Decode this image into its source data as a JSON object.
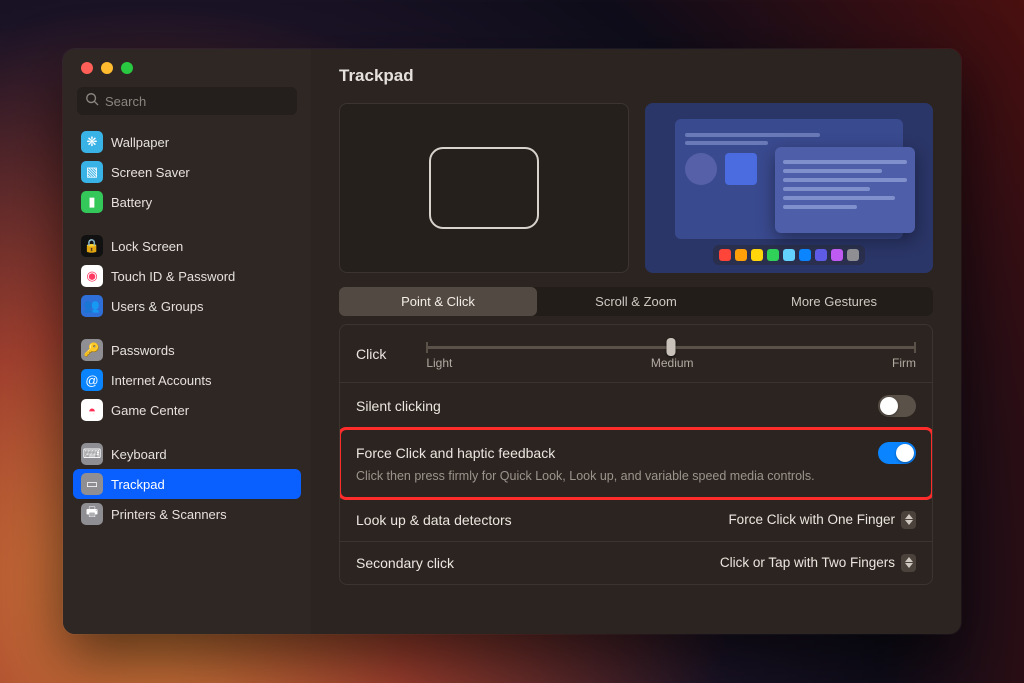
{
  "window_title": "Trackpad",
  "search": {
    "placeholder": "Search"
  },
  "accent_color": "#0a60ff",
  "sidebar": {
    "items": [
      {
        "label": "Wallpaper",
        "icon": "wallpaper-icon",
        "bg": "#39b3e6",
        "glyph": "❋"
      },
      {
        "label": "Screen Saver",
        "icon": "screensaver-icon",
        "bg": "#39b3e6",
        "glyph": "▧"
      },
      {
        "label": "Battery",
        "icon": "battery-icon",
        "bg": "#34c759",
        "glyph": "▮"
      },
      {
        "sep": true
      },
      {
        "label": "Lock Screen",
        "icon": "lock-screen-icon",
        "bg": "#111111",
        "glyph": "🔒"
      },
      {
        "label": "Touch ID & Password",
        "icon": "touchid-icon",
        "bg": "#ffffff",
        "glyph": "◉",
        "glyph_color": "#ff3b63"
      },
      {
        "label": "Users & Groups",
        "icon": "users-groups-icon",
        "bg": "#2e6fd8",
        "glyph": "👥"
      },
      {
        "sep": true
      },
      {
        "label": "Passwords",
        "icon": "passwords-icon",
        "bg": "#8e8e93",
        "glyph": "🔑"
      },
      {
        "label": "Internet Accounts",
        "icon": "internet-accounts-icon",
        "bg": "#0a84ff",
        "glyph": "@"
      },
      {
        "label": "Game Center",
        "icon": "game-center-icon",
        "bg": "#ffffff",
        "glyph": "◓",
        "glyph_color": "#ff2d55"
      },
      {
        "sep": true
      },
      {
        "label": "Keyboard",
        "icon": "keyboard-icon",
        "bg": "#8e8e93",
        "glyph": "⌨"
      },
      {
        "label": "Trackpad",
        "icon": "trackpad-icon",
        "bg": "#8e8e93",
        "glyph": "▭",
        "selected": true
      },
      {
        "label": "Printers & Scanners",
        "icon": "printers-icon",
        "bg": "#8e8e93",
        "glyph": "🖶"
      }
    ]
  },
  "tabs": [
    {
      "label": "Point & Click",
      "active": true
    },
    {
      "label": "Scroll & Zoom",
      "active": false
    },
    {
      "label": "More Gestures",
      "active": false
    }
  ],
  "settings": {
    "click_label": "Click",
    "click_levels": [
      "Light",
      "Medium",
      "Firm"
    ],
    "click_value": "Medium",
    "silent_clicking": {
      "label": "Silent clicking",
      "on": false
    },
    "force_click": {
      "label": "Force Click and haptic feedback",
      "sub": "Click then press firmly for Quick Look, Look up, and variable speed media controls.",
      "on": true,
      "highlighted": true
    },
    "lookup": {
      "label": "Look up & data detectors",
      "value": "Force Click with One Finger"
    },
    "secondary": {
      "label": "Secondary click",
      "value": "Click or Tap with Two Fingers"
    }
  },
  "dock_colors": [
    "#ff453a",
    "#ff9f0a",
    "#ffd60a",
    "#30d158",
    "#64d2ff",
    "#0a84ff",
    "#5e5ce6",
    "#bf5af2",
    "#8e8e93"
  ]
}
